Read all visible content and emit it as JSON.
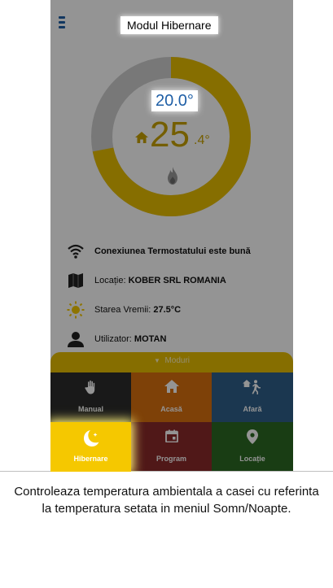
{
  "header": {
    "title": "Modul Hibernare",
    "menu_icon": "hamburger-menu-icon"
  },
  "thermostat": {
    "setpoint": "20.0°",
    "current_temp": "25",
    "current_decimal": ".4°",
    "home_icon": "house-icon",
    "flame_icon": "flame-icon",
    "gauge_level": 0.72,
    "colors": {
      "arc_active": "#e7bd00",
      "arc_track": "#cfcfcf",
      "setpoint_text": "#1f5fa6"
    }
  },
  "info": [
    {
      "icon": "wifi-icon",
      "label": "",
      "value": "Conexiunea Termostatului este bună"
    },
    {
      "icon": "map-icon",
      "label": "Locație: ",
      "value": "KOBER SRL ROMANIA"
    },
    {
      "icon": "sun-icon",
      "label": "Starea Vremii: ",
      "value": "27.5°C"
    },
    {
      "icon": "user-icon",
      "label": "Utilizator: ",
      "value": "MOTAN"
    }
  ],
  "modes": {
    "header": "Moduri",
    "header_icon": "triangle-down-icon",
    "tiles": [
      {
        "label": "Manual",
        "icon": "hand-icon",
        "color": "#2b2b2b"
      },
      {
        "label": "Acasă",
        "icon": "house-icon",
        "color": "#d9700f"
      },
      {
        "label": "Afară",
        "icon": "walking-person-icon",
        "color": "#2f5f8a"
      },
      {
        "label": "Hibernare",
        "icon": "moon-icon",
        "color": "#f5c800",
        "selected": true
      },
      {
        "label": "Program",
        "icon": "calendar-icon",
        "color": "#8a2a2a"
      },
      {
        "label": "Locație",
        "icon": "location-pin-icon",
        "color": "#2c6a24"
      }
    ]
  },
  "caption": "Controleaza temperatura ambientala a casei cu referinta la temperatura setata in meniul Somn/Noapte."
}
